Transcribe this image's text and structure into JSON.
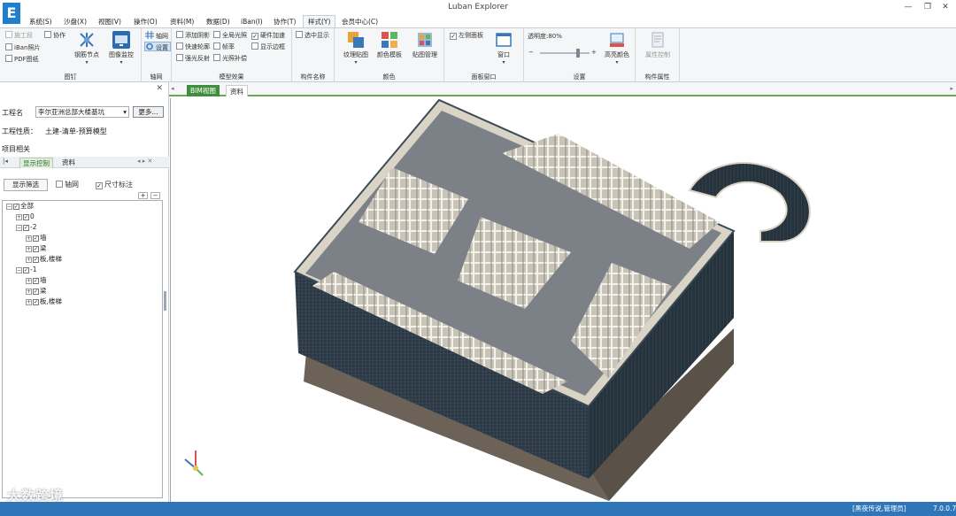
{
  "window": {
    "title": "Luban Explorer",
    "logo": "E"
  },
  "menu": {
    "tabs": [
      "系统(S)",
      "沙盘(X)",
      "视图(V)",
      "操作(O)",
      "资料(M)",
      "数据(D)",
      "iBan(I)",
      "协作(T)",
      "样式(Y)",
      "会员中心(C)"
    ],
    "active": "样式(Y)"
  },
  "ribbon": {
    "collab": {
      "items": [
        "施工段",
        "协作",
        "iBan照片",
        "PDF图纸"
      ],
      "rebar_btn": "钢筋节点",
      "monitor_btn": "图像监控",
      "label": "图钉"
    },
    "axis": {
      "axis": "轴网",
      "settings": "设置",
      "label": "轴网"
    },
    "model": {
      "items": [
        "添加阴影",
        "全局光照",
        "硬件加速",
        "快速轮廓",
        "帧率",
        "显示边框",
        "强光反射",
        "光照补偿"
      ],
      "label": "模型效果"
    },
    "component": {
      "item": "选中显示",
      "label": "构件名称"
    },
    "color": {
      "btns": [
        "纹理贴图",
        "颜色模板",
        "贴图管理"
      ],
      "label": "颜色"
    },
    "panel": {
      "item": "左侧面板",
      "window_btn": "窗口",
      "label": "面板窗口"
    },
    "settings": {
      "transparency": "透明度:80%",
      "minus": "−",
      "plus": "+",
      "highlight_btn": "高亮颜色",
      "label": "设置"
    },
    "props": {
      "btn": "属性控制",
      "label": "构件属性"
    }
  },
  "left": {
    "close": "✕",
    "project_label": "工程名",
    "project_value": "李尔亚洲总部大楼基坑",
    "more": "更多...",
    "nature_label": "工程性质：",
    "nature_value": "土建-清单-预算模型",
    "related": "项目相关",
    "subtabs": [
      "显示控制",
      "资料"
    ],
    "filter": "显示筛选",
    "axis_cb": "轴网",
    "dim_cb": "尺寸标注",
    "plus": "+",
    "minus": "−",
    "tree": [
      "全部",
      "0",
      "-2",
      "墙",
      "梁",
      "板,楼梯",
      "-1",
      "墙",
      "梁",
      "板,楼梯"
    ]
  },
  "doctabs": [
    "BIM视图",
    "资料"
  ],
  "status": {
    "user": "[黑夜传说,管理员]",
    "version": "7.0.0.7"
  },
  "watermark": "大数跨境",
  "colors": {
    "accent_green": "#3e8e3e",
    "status_blue": "#2f76b9",
    "facade": "#2f3b46",
    "slab": "#6b6f76"
  }
}
